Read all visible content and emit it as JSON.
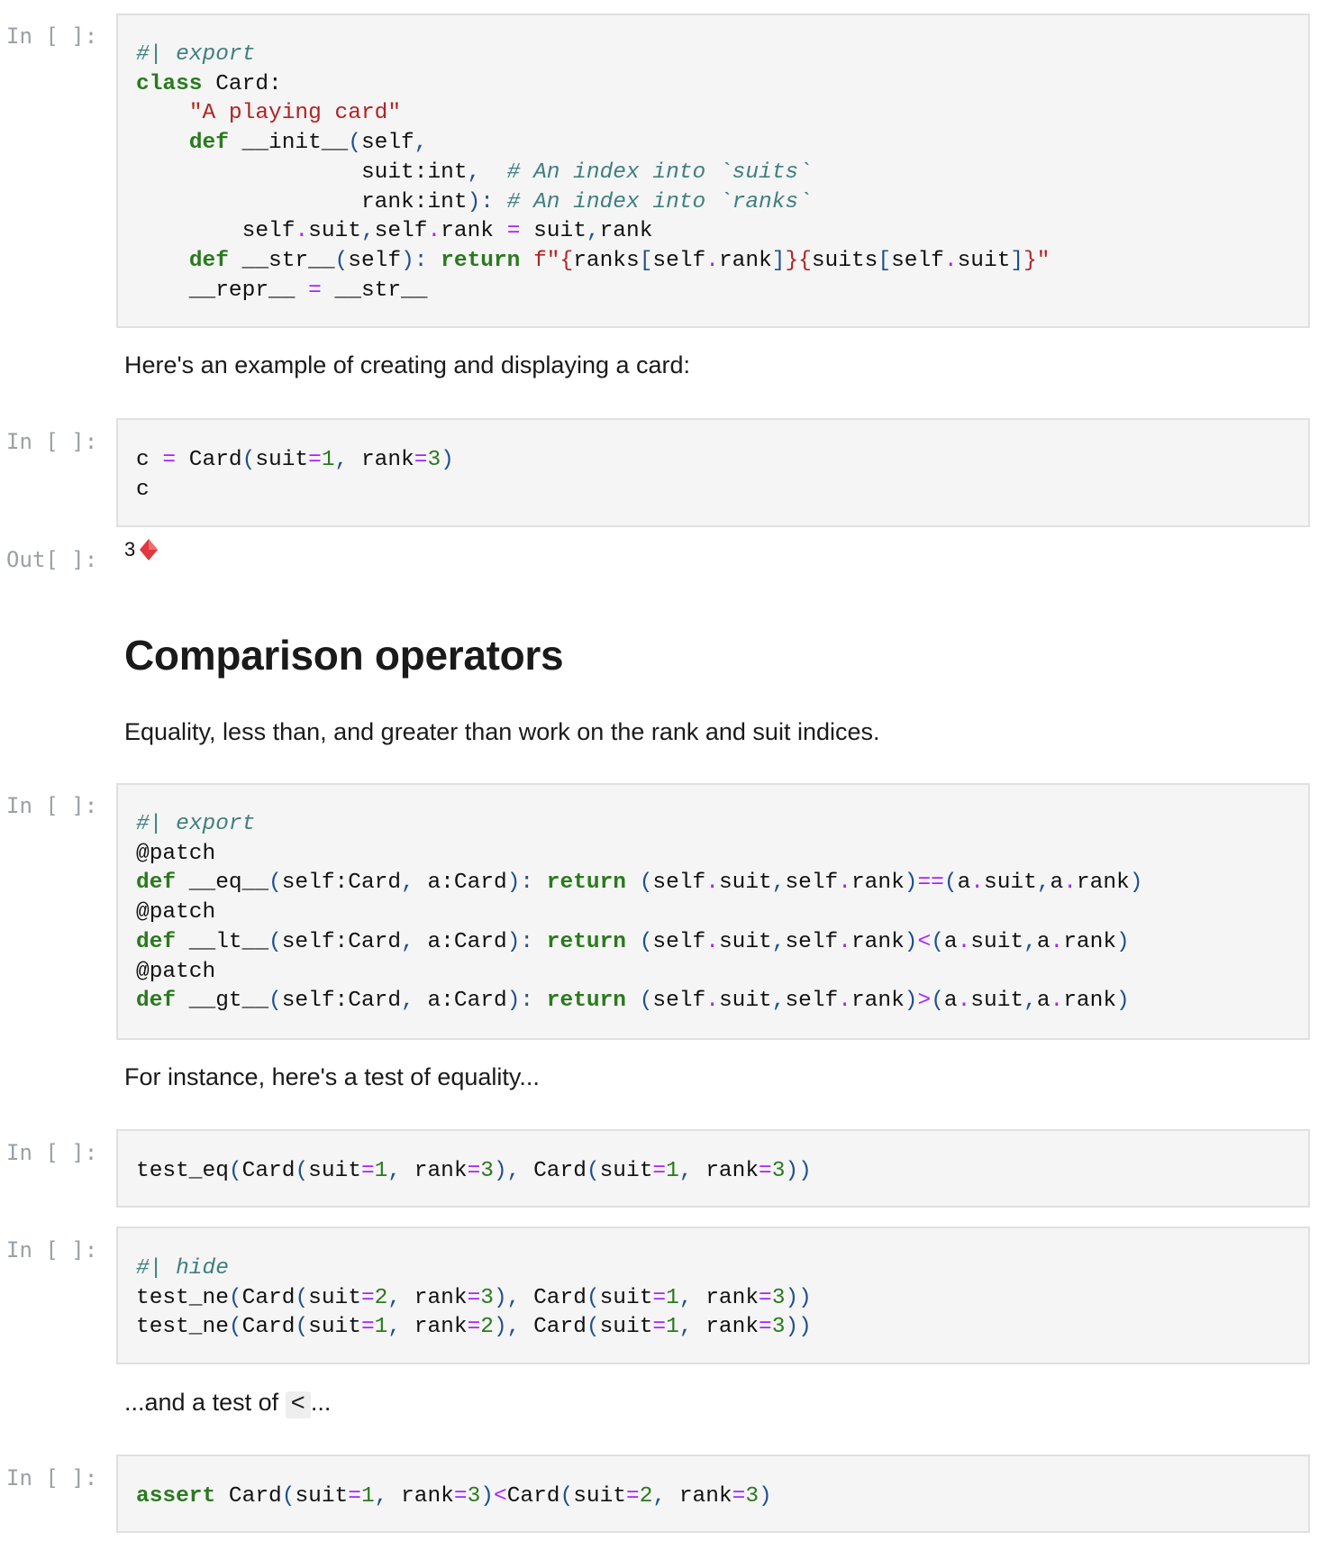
{
  "prompts": {
    "in": "In [ ]:",
    "out": "Out[ ]:"
  },
  "cells": {
    "cell1": {
      "lines": [
        [
          {
            "t": "#| export",
            "c": "c"
          }
        ],
        [
          {
            "t": "class",
            "c": "k"
          },
          {
            "t": " Card:",
            "c": ""
          }
        ],
        [
          {
            "t": "    ",
            "c": ""
          },
          {
            "t": "\"A playing card\"",
            "c": "s"
          }
        ],
        [
          {
            "t": "    ",
            "c": ""
          },
          {
            "t": "def",
            "c": "k"
          },
          {
            "t": " __init__",
            "c": ""
          },
          {
            "t": "(",
            "c": "p"
          },
          {
            "t": "self",
            "c": ""
          },
          {
            "t": ",",
            "c": "p"
          }
        ],
        [
          {
            "t": "                 suit:int",
            "c": ""
          },
          {
            "t": ",",
            "c": "p"
          },
          {
            "t": "  ",
            "c": ""
          },
          {
            "t": "# An index into `suits`",
            "c": "c"
          }
        ],
        [
          {
            "t": "                 rank:int",
            "c": ""
          },
          {
            "t": "):",
            "c": "p"
          },
          {
            "t": " ",
            "c": ""
          },
          {
            "t": "# An index into `ranks`",
            "c": "c"
          }
        ],
        [
          {
            "t": "        self",
            "c": ""
          },
          {
            "t": ".",
            "c": "o"
          },
          {
            "t": "suit",
            "c": ""
          },
          {
            "t": ",",
            "c": "p"
          },
          {
            "t": "self",
            "c": ""
          },
          {
            "t": ".",
            "c": "o"
          },
          {
            "t": "rank ",
            "c": ""
          },
          {
            "t": "=",
            "c": "o"
          },
          {
            "t": " suit",
            "c": ""
          },
          {
            "t": ",",
            "c": "p"
          },
          {
            "t": "rank",
            "c": ""
          }
        ],
        [
          {
            "t": "    ",
            "c": ""
          },
          {
            "t": "def",
            "c": "k"
          },
          {
            "t": " __str__",
            "c": ""
          },
          {
            "t": "(",
            "c": "p"
          },
          {
            "t": "self",
            "c": ""
          },
          {
            "t": "):",
            "c": "p"
          },
          {
            "t": " ",
            "c": ""
          },
          {
            "t": "return",
            "c": "k"
          },
          {
            "t": " ",
            "c": ""
          },
          {
            "t": "f\"{",
            "c": "s"
          },
          {
            "t": "ranks",
            "c": ""
          },
          {
            "t": "[",
            "c": "p"
          },
          {
            "t": "self",
            "c": ""
          },
          {
            "t": ".",
            "c": "o"
          },
          {
            "t": "rank",
            "c": ""
          },
          {
            "t": "]",
            "c": "p"
          },
          {
            "t": "}{",
            "c": "s"
          },
          {
            "t": "suits",
            "c": ""
          },
          {
            "t": "[",
            "c": "p"
          },
          {
            "t": "self",
            "c": ""
          },
          {
            "t": ".",
            "c": "o"
          },
          {
            "t": "suit",
            "c": ""
          },
          {
            "t": "]",
            "c": "p"
          },
          {
            "t": "}\"",
            "c": "s"
          }
        ],
        [
          {
            "t": "    __repr__ ",
            "c": ""
          },
          {
            "t": "=",
            "c": "o"
          },
          {
            "t": " __str__",
            "c": ""
          }
        ]
      ]
    },
    "md1": {
      "text": "Here's an example of creating and displaying a card:"
    },
    "cell2": {
      "lines": [
        [
          {
            "t": "c ",
            "c": ""
          },
          {
            "t": "=",
            "c": "o"
          },
          {
            "t": " Card",
            "c": ""
          },
          {
            "t": "(",
            "c": "p"
          },
          {
            "t": "suit",
            "c": ""
          },
          {
            "t": "=",
            "c": "o"
          },
          {
            "t": "1",
            "c": "n"
          },
          {
            "t": ",",
            "c": "p"
          },
          {
            "t": " rank",
            "c": ""
          },
          {
            "t": "=",
            "c": "o"
          },
          {
            "t": "3",
            "c": "n"
          },
          {
            "t": ")",
            "c": "p"
          }
        ],
        [
          {
            "t": "c",
            "c": ""
          }
        ]
      ],
      "output_rank": "3",
      "output_suit_icon": "diamond-icon",
      "output_suit_color": "#e0383e"
    },
    "md2": {
      "heading": "Comparison operators",
      "text": "Equality, less than, and greater than work on the rank and suit indices."
    },
    "cell3": {
      "lines": [
        [
          {
            "t": "#| export",
            "c": "c"
          }
        ],
        [
          {
            "t": "@patch",
            "c": ""
          }
        ],
        [
          {
            "t": "def",
            "c": "k"
          },
          {
            "t": " __eq__",
            "c": ""
          },
          {
            "t": "(",
            "c": "p"
          },
          {
            "t": "self:Card",
            "c": ""
          },
          {
            "t": ",",
            "c": "p"
          },
          {
            "t": " a:Card",
            "c": ""
          },
          {
            "t": "):",
            "c": "p"
          },
          {
            "t": " ",
            "c": ""
          },
          {
            "t": "return",
            "c": "k"
          },
          {
            "t": " ",
            "c": ""
          },
          {
            "t": "(",
            "c": "p"
          },
          {
            "t": "self",
            "c": ""
          },
          {
            "t": ".",
            "c": "o"
          },
          {
            "t": "suit",
            "c": ""
          },
          {
            "t": ",",
            "c": "p"
          },
          {
            "t": "self",
            "c": ""
          },
          {
            "t": ".",
            "c": "o"
          },
          {
            "t": "rank",
            "c": ""
          },
          {
            "t": ")",
            "c": "p"
          },
          {
            "t": "==",
            "c": "o"
          },
          {
            "t": "(",
            "c": "p"
          },
          {
            "t": "a",
            "c": ""
          },
          {
            "t": ".",
            "c": "o"
          },
          {
            "t": "suit",
            "c": ""
          },
          {
            "t": ",",
            "c": "p"
          },
          {
            "t": "a",
            "c": ""
          },
          {
            "t": ".",
            "c": "o"
          },
          {
            "t": "rank",
            "c": ""
          },
          {
            "t": ")",
            "c": "p"
          }
        ],
        [
          {
            "t": "@patch",
            "c": ""
          }
        ],
        [
          {
            "t": "def",
            "c": "k"
          },
          {
            "t": " __lt__",
            "c": ""
          },
          {
            "t": "(",
            "c": "p"
          },
          {
            "t": "self:Card",
            "c": ""
          },
          {
            "t": ",",
            "c": "p"
          },
          {
            "t": " a:Card",
            "c": ""
          },
          {
            "t": "):",
            "c": "p"
          },
          {
            "t": " ",
            "c": ""
          },
          {
            "t": "return",
            "c": "k"
          },
          {
            "t": " ",
            "c": ""
          },
          {
            "t": "(",
            "c": "p"
          },
          {
            "t": "self",
            "c": ""
          },
          {
            "t": ".",
            "c": "o"
          },
          {
            "t": "suit",
            "c": ""
          },
          {
            "t": ",",
            "c": "p"
          },
          {
            "t": "self",
            "c": ""
          },
          {
            "t": ".",
            "c": "o"
          },
          {
            "t": "rank",
            "c": ""
          },
          {
            "t": ")",
            "c": "p"
          },
          {
            "t": "<",
            "c": "o"
          },
          {
            "t": "(",
            "c": "p"
          },
          {
            "t": "a",
            "c": ""
          },
          {
            "t": ".",
            "c": "o"
          },
          {
            "t": "suit",
            "c": ""
          },
          {
            "t": ",",
            "c": "p"
          },
          {
            "t": "a",
            "c": ""
          },
          {
            "t": ".",
            "c": "o"
          },
          {
            "t": "rank",
            "c": ""
          },
          {
            "t": ")",
            "c": "p"
          }
        ],
        [
          {
            "t": "@patch",
            "c": ""
          }
        ],
        [
          {
            "t": "def",
            "c": "k"
          },
          {
            "t": " __gt__",
            "c": ""
          },
          {
            "t": "(",
            "c": "p"
          },
          {
            "t": "self:Card",
            "c": ""
          },
          {
            "t": ",",
            "c": "p"
          },
          {
            "t": " a:Card",
            "c": ""
          },
          {
            "t": "):",
            "c": "p"
          },
          {
            "t": " ",
            "c": ""
          },
          {
            "t": "return",
            "c": "k"
          },
          {
            "t": " ",
            "c": ""
          },
          {
            "t": "(",
            "c": "p"
          },
          {
            "t": "self",
            "c": ""
          },
          {
            "t": ".",
            "c": "o"
          },
          {
            "t": "suit",
            "c": ""
          },
          {
            "t": ",",
            "c": "p"
          },
          {
            "t": "self",
            "c": ""
          },
          {
            "t": ".",
            "c": "o"
          },
          {
            "t": "rank",
            "c": ""
          },
          {
            "t": ")",
            "c": "p"
          },
          {
            "t": ">",
            "c": "o"
          },
          {
            "t": "(",
            "c": "p"
          },
          {
            "t": "a",
            "c": ""
          },
          {
            "t": ".",
            "c": "o"
          },
          {
            "t": "suit",
            "c": ""
          },
          {
            "t": ",",
            "c": "p"
          },
          {
            "t": "a",
            "c": ""
          },
          {
            "t": ".",
            "c": "o"
          },
          {
            "t": "rank",
            "c": ""
          },
          {
            "t": ")",
            "c": "p"
          }
        ]
      ]
    },
    "md3": {
      "text": "For instance, here's a test of equality..."
    },
    "cell4": {
      "lines": [
        [
          {
            "t": "test_eq",
            "c": ""
          },
          {
            "t": "(",
            "c": "p"
          },
          {
            "t": "Card",
            "c": ""
          },
          {
            "t": "(",
            "c": "p"
          },
          {
            "t": "suit",
            "c": ""
          },
          {
            "t": "=",
            "c": "o"
          },
          {
            "t": "1",
            "c": "n"
          },
          {
            "t": ",",
            "c": "p"
          },
          {
            "t": " rank",
            "c": ""
          },
          {
            "t": "=",
            "c": "o"
          },
          {
            "t": "3",
            "c": "n"
          },
          {
            "t": "),",
            "c": "p"
          },
          {
            "t": " Card",
            "c": ""
          },
          {
            "t": "(",
            "c": "p"
          },
          {
            "t": "suit",
            "c": ""
          },
          {
            "t": "=",
            "c": "o"
          },
          {
            "t": "1",
            "c": "n"
          },
          {
            "t": ",",
            "c": "p"
          },
          {
            "t": " rank",
            "c": ""
          },
          {
            "t": "=",
            "c": "o"
          },
          {
            "t": "3",
            "c": "n"
          },
          {
            "t": "))",
            "c": "p"
          }
        ]
      ]
    },
    "cell5": {
      "lines": [
        [
          {
            "t": "#| hide",
            "c": "c"
          }
        ],
        [
          {
            "t": "test_ne",
            "c": ""
          },
          {
            "t": "(",
            "c": "p"
          },
          {
            "t": "Card",
            "c": ""
          },
          {
            "t": "(",
            "c": "p"
          },
          {
            "t": "suit",
            "c": ""
          },
          {
            "t": "=",
            "c": "o"
          },
          {
            "t": "2",
            "c": "n"
          },
          {
            "t": ",",
            "c": "p"
          },
          {
            "t": " rank",
            "c": ""
          },
          {
            "t": "=",
            "c": "o"
          },
          {
            "t": "3",
            "c": "n"
          },
          {
            "t": "),",
            "c": "p"
          },
          {
            "t": " Card",
            "c": ""
          },
          {
            "t": "(",
            "c": "p"
          },
          {
            "t": "suit",
            "c": ""
          },
          {
            "t": "=",
            "c": "o"
          },
          {
            "t": "1",
            "c": "n"
          },
          {
            "t": ",",
            "c": "p"
          },
          {
            "t": " rank",
            "c": ""
          },
          {
            "t": "=",
            "c": "o"
          },
          {
            "t": "3",
            "c": "n"
          },
          {
            "t": "))",
            "c": "p"
          }
        ],
        [
          {
            "t": "test_ne",
            "c": ""
          },
          {
            "t": "(",
            "c": "p"
          },
          {
            "t": "Card",
            "c": ""
          },
          {
            "t": "(",
            "c": "p"
          },
          {
            "t": "suit",
            "c": ""
          },
          {
            "t": "=",
            "c": "o"
          },
          {
            "t": "1",
            "c": "n"
          },
          {
            "t": ",",
            "c": "p"
          },
          {
            "t": " rank",
            "c": ""
          },
          {
            "t": "=",
            "c": "o"
          },
          {
            "t": "2",
            "c": "n"
          },
          {
            "t": "),",
            "c": "p"
          },
          {
            "t": " Card",
            "c": ""
          },
          {
            "t": "(",
            "c": "p"
          },
          {
            "t": "suit",
            "c": ""
          },
          {
            "t": "=",
            "c": "o"
          },
          {
            "t": "1",
            "c": "n"
          },
          {
            "t": ",",
            "c": "p"
          },
          {
            "t": " rank",
            "c": ""
          },
          {
            "t": "=",
            "c": "o"
          },
          {
            "t": "3",
            "c": "n"
          },
          {
            "t": "))",
            "c": "p"
          }
        ]
      ]
    },
    "md4": {
      "before": "...and a test of",
      "code": "<",
      "after": "..."
    },
    "cell6": {
      "lines": [
        [
          {
            "t": "assert",
            "c": "k"
          },
          {
            "t": " Card",
            "c": ""
          },
          {
            "t": "(",
            "c": "p"
          },
          {
            "t": "suit",
            "c": ""
          },
          {
            "t": "=",
            "c": "o"
          },
          {
            "t": "1",
            "c": "n"
          },
          {
            "t": ",",
            "c": "p"
          },
          {
            "t": " rank",
            "c": ""
          },
          {
            "t": "=",
            "c": "o"
          },
          {
            "t": "3",
            "c": "n"
          },
          {
            "t": ")",
            "c": "p"
          },
          {
            "t": "<",
            "c": "o"
          },
          {
            "t": "Card",
            "c": ""
          },
          {
            "t": "(",
            "c": "p"
          },
          {
            "t": "suit",
            "c": ""
          },
          {
            "t": "=",
            "c": "o"
          },
          {
            "t": "2",
            "c": "n"
          },
          {
            "t": ",",
            "c": "p"
          },
          {
            "t": " rank",
            "c": ""
          },
          {
            "t": "=",
            "c": "o"
          },
          {
            "t": "3",
            "c": "n"
          },
          {
            "t": ")",
            "c": "p"
          }
        ]
      ]
    }
  }
}
